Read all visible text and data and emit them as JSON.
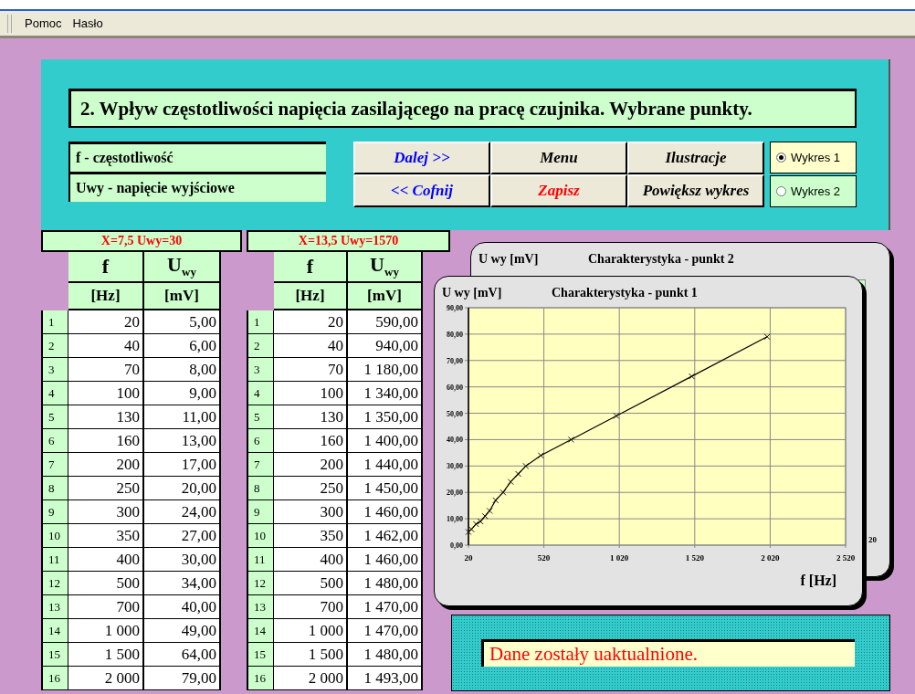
{
  "menu": [
    {
      "label": "Pomoc"
    },
    {
      "label": "Hasło"
    }
  ],
  "header": {
    "title": "2. Wpływ częstotliwości napięcia zasilającego na pracę czujnika. Wybrane punkty.",
    "legend": [
      "f - częstotliwość",
      "Uwy - napięcie wyjściowe"
    ],
    "buttons": [
      {
        "label": "Dalej >>",
        "color": "#0000ff"
      },
      {
        "label": "Menu",
        "color": "#000000"
      },
      {
        "label": "Ilustracje",
        "color": "#000000"
      },
      {
        "label": "<< Cofnij",
        "color": "#0000ff"
      },
      {
        "label": "Zapisz",
        "color": "#ff0000"
      },
      {
        "label": "Powiększ wykres",
        "color": "#000000"
      }
    ],
    "radios": [
      {
        "label": "Wykres 1",
        "selected": true
      },
      {
        "label": "Wykres 2",
        "selected": false
      }
    ]
  },
  "tables": [
    {
      "title": "X=7,5 Uwy=30",
      "columns": [
        {},
        {
          "name": "f",
          "unit": "[Hz]"
        },
        {
          "name": "U$_{wy}$",
          "unit": "[mV]"
        }
      ],
      "rows": [
        [
          "1",
          "20",
          "5,00"
        ],
        [
          "2",
          "40",
          "6,00"
        ],
        [
          "3",
          "70",
          "8,00"
        ],
        [
          "4",
          "100",
          "9,00"
        ],
        [
          "5",
          "130",
          "11,00"
        ],
        [
          "6",
          "160",
          "13,00"
        ],
        [
          "7",
          "200",
          "17,00"
        ],
        [
          "8",
          "250",
          "20,00"
        ],
        [
          "9",
          "300",
          "24,00"
        ],
        [
          "10",
          "350",
          "27,00"
        ],
        [
          "11",
          "400",
          "30,00"
        ],
        [
          "12",
          "500",
          "34,00"
        ],
        [
          "13",
          "700",
          "40,00"
        ],
        [
          "14",
          "1 000",
          "49,00"
        ],
        [
          "15",
          "1 500",
          "64,00"
        ],
        [
          "16",
          "2 000",
          "79,00"
        ]
      ]
    },
    {
      "title": "X=13,5 Uwy=1570",
      "columns": [
        {},
        {
          "name": "f",
          "unit": "[Hz]"
        },
        {
          "name": "U$_{wy}$",
          "unit": "[mV]"
        }
      ],
      "rows": [
        [
          "1",
          "20",
          "590,00"
        ],
        [
          "2",
          "40",
          "940,00"
        ],
        [
          "3",
          "70",
          "1 180,00"
        ],
        [
          "4",
          "100",
          "1 340,00"
        ],
        [
          "5",
          "130",
          "1 350,00"
        ],
        [
          "6",
          "160",
          "1 400,00"
        ],
        [
          "7",
          "200",
          "1 440,00"
        ],
        [
          "8",
          "250",
          "1 450,00"
        ],
        [
          "9",
          "300",
          "1 460,00"
        ],
        [
          "10",
          "350",
          "1 462,00"
        ],
        [
          "11",
          "400",
          "1 460,00"
        ],
        [
          "12",
          "500",
          "1 480,00"
        ],
        [
          "13",
          "700",
          "1 470,00"
        ],
        [
          "14",
          "1 000",
          "1 470,00"
        ],
        [
          "15",
          "1 500",
          "1 480,00"
        ],
        [
          "16",
          "2 000",
          "1 493,00"
        ]
      ]
    }
  ],
  "back_chart": {
    "title": "Charakterystyka - punkt 2",
    "ylabel": "U wy [mV]",
    "tick_fragment": "20"
  },
  "front_chart": {
    "chart_data": {
      "type": "line",
      "title": "Charakterystyka - punkt 1",
      "xlabel": "f [Hz]",
      "ylabel": "U wy [mV]",
      "x": [
        20,
        40,
        70,
        100,
        130,
        160,
        200,
        250,
        300,
        350,
        400,
        500,
        700,
        1000,
        1500,
        2000
      ],
      "grid": true,
      "series": [
        {
          "color": "#000000",
          "marker": "x",
          "values": [
            5,
            6,
            8,
            9,
            11,
            13,
            17,
            20,
            24,
            27,
            30,
            34,
            40,
            49,
            64,
            79
          ]
        }
      ],
      "xlim": [
        20,
        2520
      ],
      "ylim": [
        0,
        90
      ],
      "xticks": [
        {
          "value": 20,
          "label": "20"
        },
        {
          "value": 520,
          "label": "520"
        },
        {
          "value": 1020,
          "label": "1 020"
        },
        {
          "value": 1520,
          "label": "1 520"
        },
        {
          "value": 2020,
          "label": "2 020"
        },
        {
          "value": 2520,
          "label": "2 520"
        }
      ],
      "yticks": [
        {
          "value": 0,
          "label": "0,00"
        },
        {
          "value": 10,
          "label": "10,00"
        },
        {
          "value": 20,
          "label": "20,00"
        },
        {
          "value": 30,
          "label": "30,00"
        },
        {
          "value": 40,
          "label": "40,00"
        },
        {
          "value": 50,
          "label": "50,00"
        },
        {
          "value": 60,
          "label": "60,00"
        },
        {
          "value": 70,
          "label": "70,00"
        },
        {
          "value": 80,
          "label": "80,00"
        },
        {
          "value": 90,
          "label": "90,00"
        }
      ]
    }
  },
  "status": {
    "message": "Dane zostały uaktualnione."
  }
}
